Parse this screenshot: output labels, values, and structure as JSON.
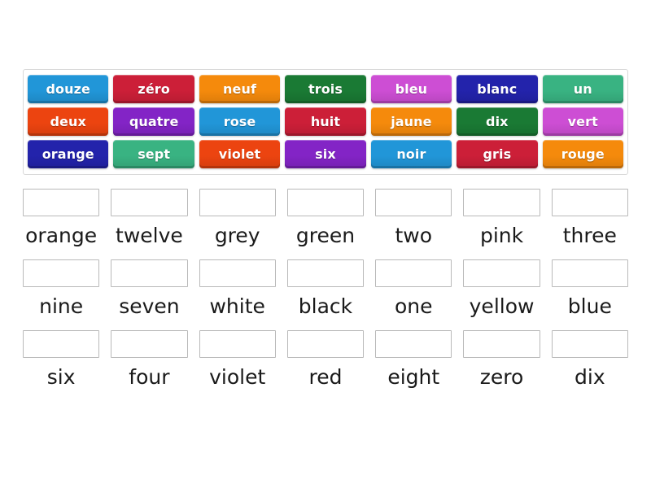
{
  "activity": {
    "type": "match-up-drag-and-drop",
    "title": ""
  },
  "tile_bank": {
    "name": "french-words-tile-bank",
    "rows": [
      [
        {
          "label": "douze",
          "color": "#2196d8"
        },
        {
          "label": "zéro",
          "color": "#cc1f38"
        },
        {
          "label": "neuf",
          "color": "#f58a0c"
        },
        {
          "label": "trois",
          "color": "#1a7a34"
        },
        {
          "label": "bleu",
          "color": "#cd4ed4"
        },
        {
          "label": "blanc",
          "color": "#2323ab"
        },
        {
          "label": "un",
          "color": "#39b382"
        }
      ],
      [
        {
          "label": "deux",
          "color": "#ec4410"
        },
        {
          "label": "quatre",
          "color": "#8324c6"
        },
        {
          "label": "rose",
          "color": "#2196d8"
        },
        {
          "label": "huit",
          "color": "#cc1f38"
        },
        {
          "label": "jaune",
          "color": "#f58a0c"
        },
        {
          "label": "dix",
          "color": "#1a7a34"
        },
        {
          "label": "vert",
          "color": "#cd4ed4"
        }
      ],
      [
        {
          "label": "orange",
          "color": "#2323ab"
        },
        {
          "label": "sept",
          "color": "#39b382"
        },
        {
          "label": "violet",
          "color": "#ec4410"
        },
        {
          "label": "six",
          "color": "#8324c6"
        },
        {
          "label": "noir",
          "color": "#2196d8"
        },
        {
          "label": "gris",
          "color": "#cc1f38"
        },
        {
          "label": "rouge",
          "color": "#f58a0c"
        }
      ]
    ]
  },
  "answers": {
    "name": "english-answer-slots",
    "drop_value": "",
    "rows": [
      [
        {
          "label": "orange"
        },
        {
          "label": "twelve"
        },
        {
          "label": "grey"
        },
        {
          "label": "green"
        },
        {
          "label": "two"
        },
        {
          "label": "pink"
        },
        {
          "label": "three"
        }
      ],
      [
        {
          "label": "nine"
        },
        {
          "label": "seven"
        },
        {
          "label": "white"
        },
        {
          "label": "black"
        },
        {
          "label": "one"
        },
        {
          "label": "yellow"
        },
        {
          "label": "blue"
        }
      ],
      [
        {
          "label": "six"
        },
        {
          "label": "four"
        },
        {
          "label": "violet"
        },
        {
          "label": "red"
        },
        {
          "label": "eight"
        },
        {
          "label": "zero"
        },
        {
          "label": "dix"
        }
      ]
    ]
  },
  "theme": {
    "page_background": "#ffffff",
    "bank_border": "#d8d8d8",
    "drop_border": "#b9b9b9",
    "label_color": "#1a1a1a",
    "tile_text_color": "#ffffff"
  }
}
